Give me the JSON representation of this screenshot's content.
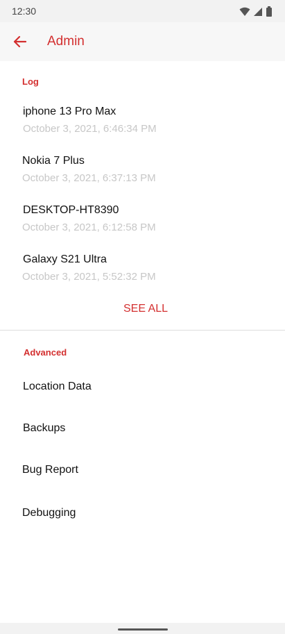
{
  "status_bar": {
    "time": "12:30",
    "icons": [
      "wifi-icon",
      "signal-icon",
      "battery-icon"
    ]
  },
  "app_bar": {
    "back_icon": "arrow-left-icon",
    "title": "Admin"
  },
  "log_section": {
    "header": "Log",
    "items": [
      {
        "name": "iphone 13 Pro Max",
        "time": "October 3, 2021, 6:46:34 PM"
      },
      {
        "name": "Nokia 7 Plus",
        "time": "October 3, 2021, 6:37:13 PM"
      },
      {
        "name": "DESKTOP-HT8390",
        "time": "October 3, 2021, 6:12:58 PM"
      },
      {
        "name": "Galaxy S21 Ultra",
        "time": "October 3, 2021, 5:52:32 PM"
      }
    ],
    "see_all": "SEE ALL"
  },
  "advanced_section": {
    "header": "Advanced",
    "items": [
      {
        "label": "Location Data"
      },
      {
        "label": "Backups"
      },
      {
        "label": "Bug Report"
      },
      {
        "label": "Debugging"
      }
    ]
  },
  "colors": {
    "accent": "#d32f2f",
    "secondary_text": "#c7c7c7",
    "status_bar_bg": "#f2f2f2"
  }
}
